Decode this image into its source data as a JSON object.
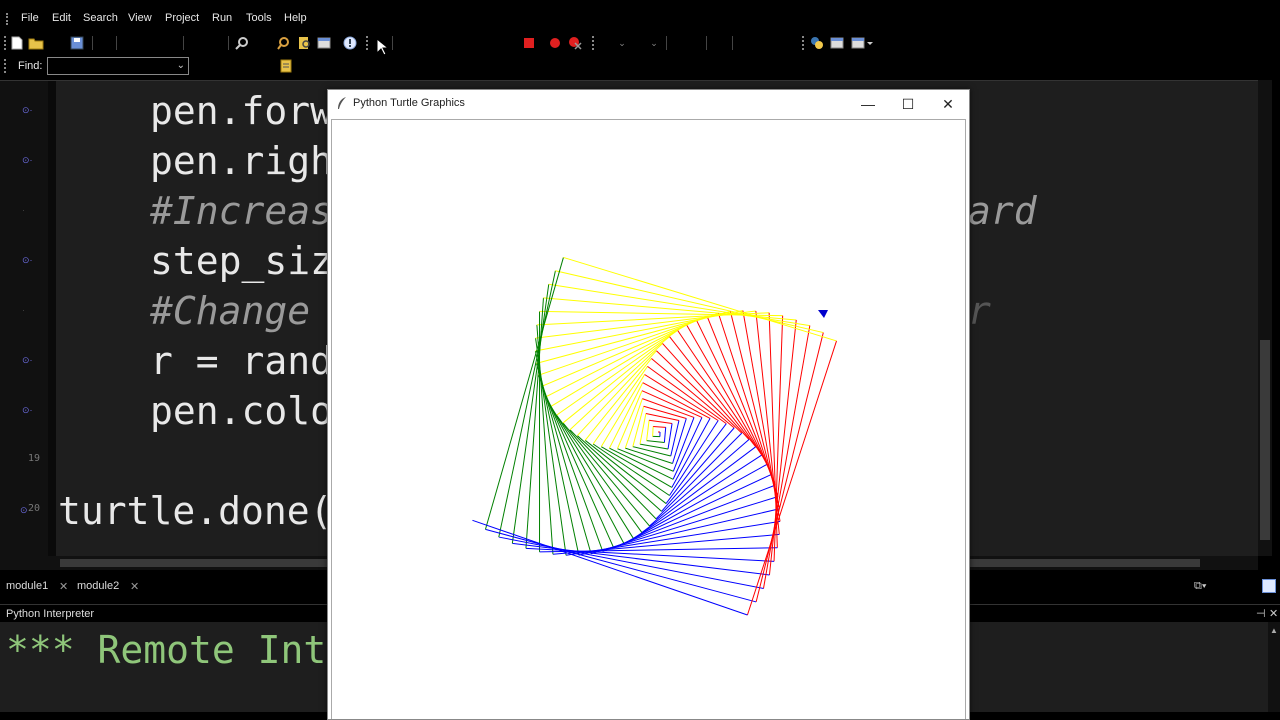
{
  "menu": [
    "File",
    "Edit",
    "Search",
    "View",
    "Project",
    "Run",
    "Tools",
    "Help"
  ],
  "find": {
    "label": "Find:",
    "value": ""
  },
  "editor": {
    "lines": [
      {
        "text": "pen.forw",
        "type": "code"
      },
      {
        "text": "pen.righ",
        "type": "code"
      },
      {
        "text": "#Increas",
        "type": "comment"
      },
      {
        "text": "step_siz",
        "type": "code"
      },
      {
        "text": "#Change ",
        "type": "comment"
      },
      {
        "text": "r = rand",
        "type": "code"
      },
      {
        "text": "pen.colo",
        "type": "code"
      },
      {
        "text": "",
        "type": "code"
      },
      {
        "text": "turtle.done(",
        "type": "code"
      }
    ],
    "right_fragments": {
      "line3": "ard",
      "line5": "r"
    },
    "line_numbers": {
      "line8": "19",
      "line9": "20"
    }
  },
  "tabs": [
    "module1",
    "module2"
  ],
  "interpreter": {
    "title": "Python Interpreter",
    "text": "*** Remote Int"
  },
  "turtle_window": {
    "title": "Python Turtle Graphics",
    "controls": {
      "minimize": "—",
      "maximize": "☐",
      "close": "✕"
    }
  },
  "colors": {
    "line_colors": [
      "#ff0000",
      "#0000ff",
      "#008000",
      "#ffff00"
    ],
    "turtle_cursor": "#0000cc"
  }
}
